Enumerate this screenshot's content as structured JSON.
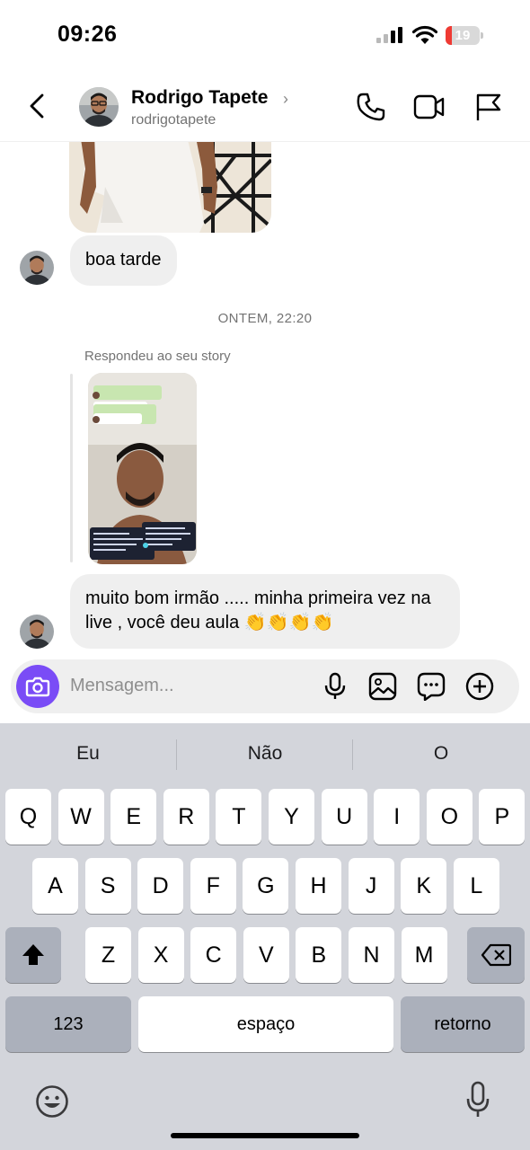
{
  "status_bar": {
    "time": "09:26",
    "battery_level": "19",
    "battery_fraction": 0.19,
    "battery_color": "#ef3a33"
  },
  "header": {
    "name": "Rodrigo Tapete",
    "chevron": "›",
    "username": "rodrigotapete",
    "icons": [
      "back-arrow-icon",
      "phone-icon",
      "video-camera-icon",
      "flag-icon"
    ]
  },
  "conversation": {
    "first_message": "boa tarde",
    "timestamp": "ONTEM, 22:20",
    "reply_label": "Respondeu ao seu story",
    "second_message": "muito bom irmão ..... minha primeira vez na live , você deu aula 👏👏👏👏"
  },
  "composer": {
    "placeholder": "Mensagem...",
    "accent_color": "#7a4cf6",
    "icons": [
      "camera-icon",
      "microphone-icon",
      "gallery-icon",
      "sticker-icon",
      "plus-icon"
    ]
  },
  "keyboard": {
    "suggestions": [
      "Eu",
      "Não",
      "O"
    ],
    "row1": [
      "Q",
      "W",
      "E",
      "R",
      "T",
      "Y",
      "U",
      "I",
      "O",
      "P"
    ],
    "row2": [
      "A",
      "S",
      "D",
      "F",
      "G",
      "H",
      "J",
      "K",
      "L"
    ],
    "row3": [
      "Z",
      "X",
      "C",
      "V",
      "B",
      "N",
      "M"
    ],
    "numbers_label": "123",
    "space_label": "espaço",
    "return_label": "retorno",
    "icons": [
      "shift-icon",
      "backspace-icon",
      "emoji-icon",
      "dictation-icon"
    ]
  }
}
